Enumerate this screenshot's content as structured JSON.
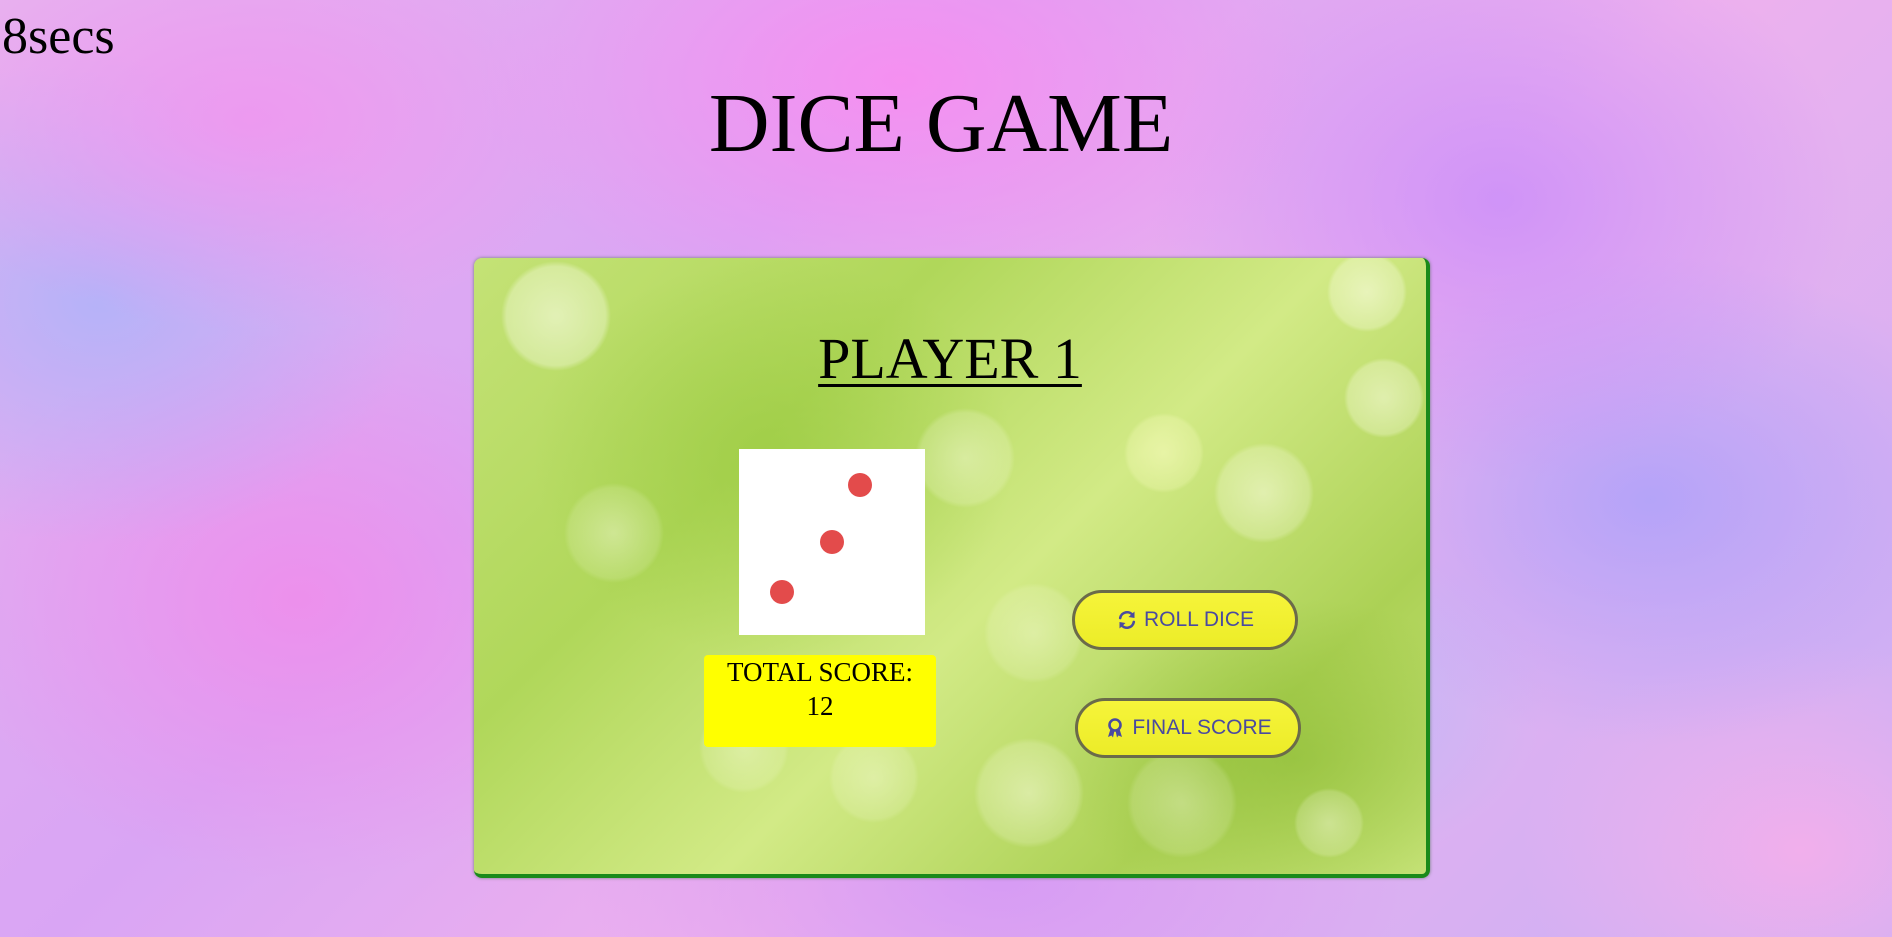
{
  "timer": {
    "text": "8secs"
  },
  "title": "DICE GAME",
  "board": {
    "player_name": "PLAYER 1",
    "die": {
      "value": 3,
      "pip_color": "#e34b4b"
    },
    "score": {
      "label": "TOTAL SCORE:",
      "value": "12"
    },
    "buttons": {
      "roll": {
        "label": "ROLL DICE",
        "icon": "refresh-icon"
      },
      "final": {
        "label": "FINAL SCORE",
        "icon": "award-icon"
      }
    }
  },
  "colors": {
    "score_bg": "#ffff00",
    "button_bg": "#f6f43a",
    "button_text": "#4a4aa0",
    "board_border": "#1a8a1a"
  }
}
